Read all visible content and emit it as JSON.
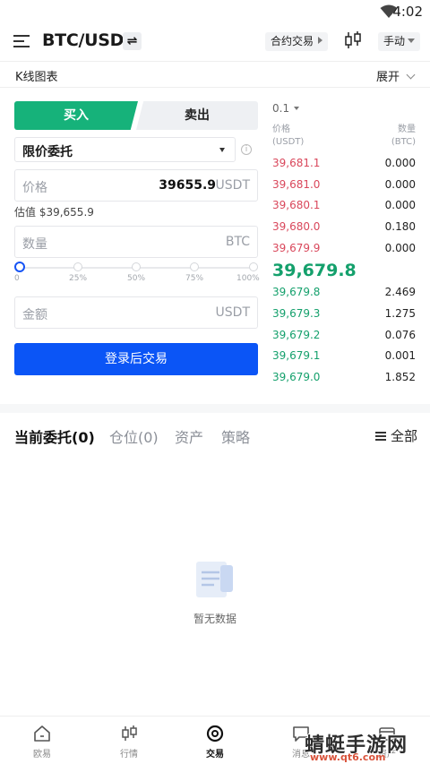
{
  "status_bar": {
    "time": "4:02",
    "wifi_icon": "wifi-icon"
  },
  "header": {
    "menu_icon": "menu-icon",
    "pair": "BTC/USDT",
    "swap_icon": "swap-icon",
    "contract_label": "合约交易",
    "kline_icon": "candlestick-icon",
    "mode_label": "手动"
  },
  "kline_bar": {
    "title": "K线图表",
    "expand_label": "展开"
  },
  "trade_form": {
    "buy_tab": "买入",
    "sell_tab": "卖出",
    "order_type": "限价委托",
    "price": {
      "placeholder": "价格",
      "value": "39655.9",
      "unit": "USDT"
    },
    "estimate": "估值 $39,655.9",
    "amount": {
      "placeholder": "数量",
      "unit": "BTC"
    },
    "slider": {
      "ticks": [
        "0",
        "25%",
        "50%",
        "75%",
        "100%"
      ],
      "level_percent": 0
    },
    "total": {
      "placeholder": "金额",
      "unit": "USDT"
    },
    "login_button": "登录后交易"
  },
  "order_book": {
    "precision": "0.1",
    "header_left": [
      "价格",
      "(USDT)"
    ],
    "header_right": [
      "数量",
      "(BTC)"
    ],
    "asks": [
      {
        "price": "39,681.1",
        "qty": "0.000"
      },
      {
        "price": "39,681.0",
        "qty": "0.000"
      },
      {
        "price": "39,680.1",
        "qty": "0.000"
      },
      {
        "price": "39,680.0",
        "qty": "0.180"
      },
      {
        "price": "39,679.9",
        "qty": "0.000"
      }
    ],
    "last_price": "39,679.8",
    "bids": [
      {
        "price": "39,679.8",
        "qty": "2.469"
      },
      {
        "price": "39,679.3",
        "qty": "1.275"
      },
      {
        "price": "39,679.2",
        "qty": "0.076"
      },
      {
        "price": "39,679.1",
        "qty": "0.001"
      },
      {
        "price": "39,679.0",
        "qty": "1.852"
      }
    ],
    "colors": {
      "ask": "#d9475b",
      "bid": "#14a06c"
    }
  },
  "orders_panel": {
    "tabs": [
      "当前委托(0)",
      "仓位(0)",
      "资产",
      "策略"
    ],
    "filter_label": "全部",
    "empty_text": "暂无数据"
  },
  "bottom_nav": {
    "items": [
      {
        "label": "欧易",
        "icon": "home-icon"
      },
      {
        "label": "行情",
        "icon": "market-icon"
      },
      {
        "label": "交易",
        "icon": "trade-icon"
      },
      {
        "label": "消息",
        "icon": "message-icon"
      },
      {
        "label": "资产",
        "icon": "wallet-icon"
      }
    ]
  },
  "watermark": {
    "brand": "蜻蜓手游网",
    "url": "www.qt6.com"
  },
  "colors": {
    "primary": "#0b55f6",
    "buy": "#16b27a"
  }
}
